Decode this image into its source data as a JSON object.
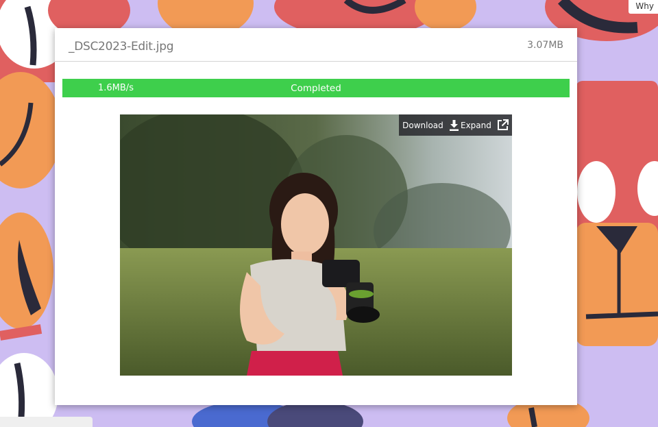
{
  "window": {
    "corner_tip": "Why"
  },
  "file": {
    "name": "_DSC2023-Edit.jpg",
    "size": "3.07MB"
  },
  "transfer": {
    "speed": "1.6MB/s",
    "status": "Completed",
    "progress_percent": 100,
    "bar_color": "#3ecf4c"
  },
  "preview_toolbar": {
    "download_label": "Download",
    "download_icon": "download-icon",
    "expand_label": "Expand",
    "expand_icon": "external-link-icon"
  },
  "colors": {
    "background": "#cdbdf2",
    "modal": "#ffffff",
    "toolbar": "#232328"
  }
}
